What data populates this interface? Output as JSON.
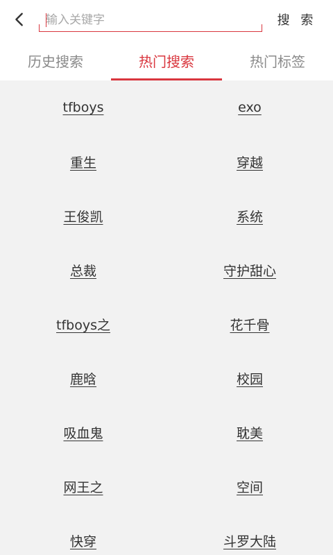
{
  "header": {
    "search_placeholder": "输入关键字",
    "search_value": "",
    "search_button_label": "搜 索"
  },
  "tabs": [
    {
      "label": "历史搜索",
      "active": false
    },
    {
      "label": "热门搜索",
      "active": true
    },
    {
      "label": "热门标签",
      "active": false
    }
  ],
  "colors": {
    "accent": "#d9363e",
    "background": "#f2f2f2",
    "text": "#333333",
    "inactive_tab": "#8a8a8a"
  },
  "keywords": [
    "tfboys",
    "exo",
    "重生",
    "穿越",
    "王俊凯",
    "系统",
    "总裁",
    "守护甜心",
    "tfboys之",
    "花千骨",
    "鹿晗",
    "校园",
    "吸血鬼",
    "耽美",
    "网王之",
    "空间",
    "快穿",
    "斗罗大陆"
  ]
}
